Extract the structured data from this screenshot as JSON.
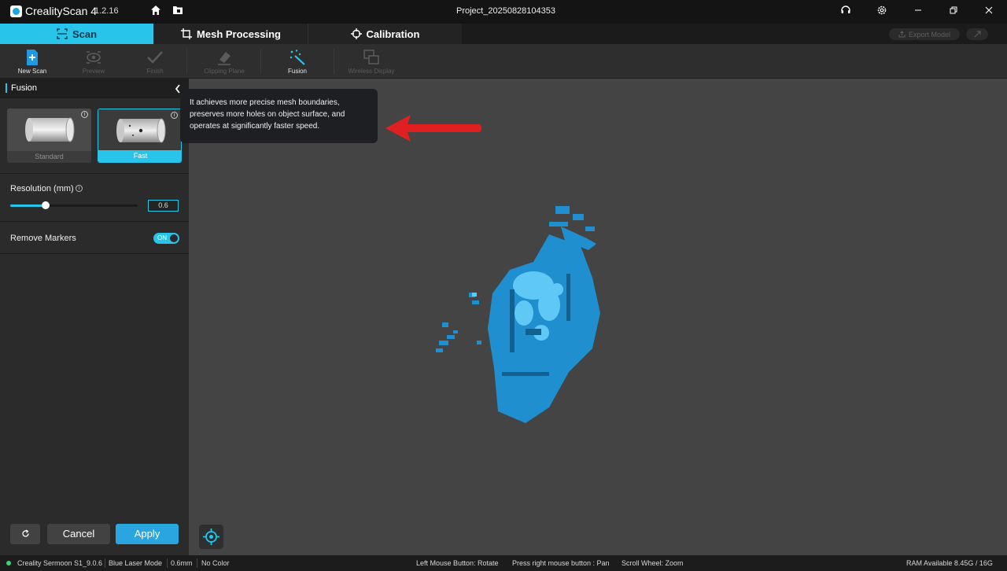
{
  "app": {
    "name": "CrealityScan 4",
    "version": "1.2.16",
    "project": "Project_20250828104353"
  },
  "titlebar": {
    "icons": [
      "home-icon",
      "folder-icon",
      "support-headset-icon",
      "settings-gear-icon",
      "minimize-icon",
      "restore-icon",
      "close-icon"
    ]
  },
  "tabs": [
    {
      "label": "Scan",
      "icon": "scan-frame-icon",
      "active": true
    },
    {
      "label": "Mesh Processing",
      "icon": "crop-icon",
      "active": false
    },
    {
      "label": "Calibration",
      "icon": "crosshair-icon",
      "active": false
    }
  ],
  "header_actions": {
    "export": "Export Model",
    "share_icon": "share-icon"
  },
  "toolbar": {
    "items": [
      {
        "label": "New Scan",
        "icon": "new-scan-icon",
        "enabled": true
      },
      {
        "label": "Preview",
        "icon": "eye-icon",
        "enabled": false
      },
      {
        "label": "Finish",
        "icon": "check-icon",
        "enabled": false
      },
      {
        "label": "Clipping Plane",
        "icon": "eraser-icon",
        "enabled": false
      },
      {
        "label": "Fusion",
        "icon": "sparkle-wand-icon",
        "enabled": true
      },
      {
        "label": "Wireless Display",
        "icon": "screens-icon",
        "enabled": false
      }
    ]
  },
  "panel": {
    "title": "Fusion",
    "modes": [
      {
        "label": "Standard",
        "selected": false
      },
      {
        "label": "Fast",
        "selected": true
      }
    ],
    "resolution": {
      "label": "Resolution (mm)",
      "value": "0.6",
      "slider_fraction": 0.28
    },
    "remove_markers": {
      "label": "Remove Markers",
      "state": "ON"
    },
    "buttons": {
      "cancel": "Cancel",
      "apply": "Apply"
    }
  },
  "tooltip": {
    "text": "It achieves more precise mesh boundaries, preserves more holes on object surface, and operates at significantly faster speed."
  },
  "statusbar": {
    "device": "Creality Sermoon S1_9.0.6",
    "mode": "Blue Laser Mode",
    "resolution": "0.6mm",
    "color": "No Color",
    "hint_rotate": "Left Mouse Button: Rotate",
    "hint_pan": "Press right mouse button : Pan",
    "hint_zoom": "Scroll Wheel: Zoom",
    "ram": "RAM Available 8.45G / 16G"
  },
  "colors": {
    "accent": "#29c4ea",
    "apply": "#29a6df",
    "model": "#1f8fd0",
    "arrow": "#e02020",
    "status_ok": "#3cd36a"
  }
}
